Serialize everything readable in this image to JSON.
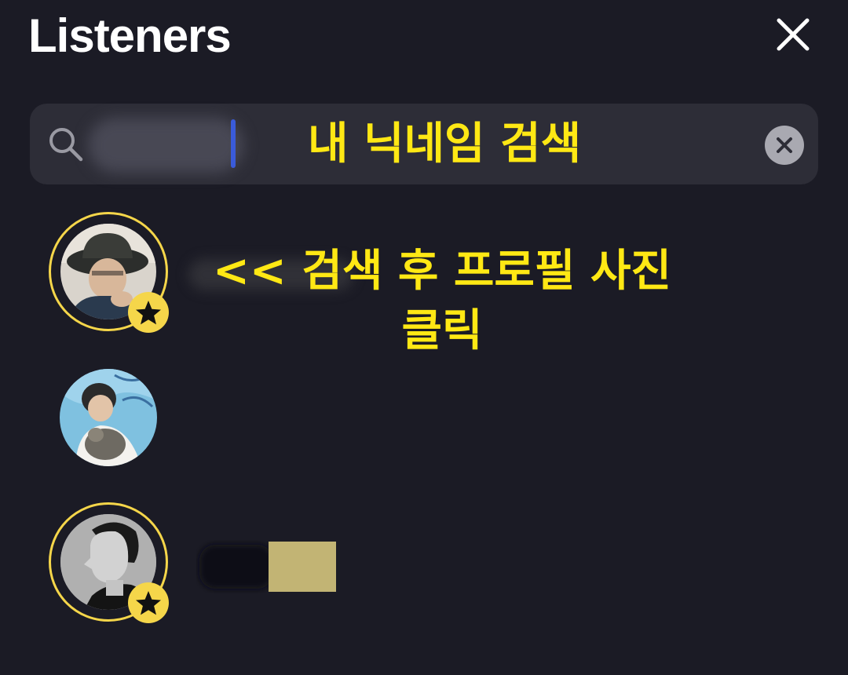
{
  "header": {
    "title": "Listeners",
    "close_icon": "close-icon"
  },
  "search": {
    "value": "",
    "icon": "search-icon",
    "clear_icon": "clear-icon"
  },
  "annotations": {
    "search_hint": "내 닉네임 검색",
    "click_hint_line1": "<< 검색 후 프로필 사진",
    "click_hint_line2": "클릭"
  },
  "listeners": [
    {
      "avatar": "avatar-bucket-hat",
      "starred": true
    },
    {
      "avatar": "avatar-with-cat",
      "starred": false
    },
    {
      "avatar": "avatar-profile-bw",
      "starred": true
    }
  ],
  "colors": {
    "background": "#1b1b25",
    "search_bg": "#2d2d37",
    "accent_ring": "#f5d64a",
    "annotation": "#ffe814",
    "cursor": "#3a5bd9"
  }
}
